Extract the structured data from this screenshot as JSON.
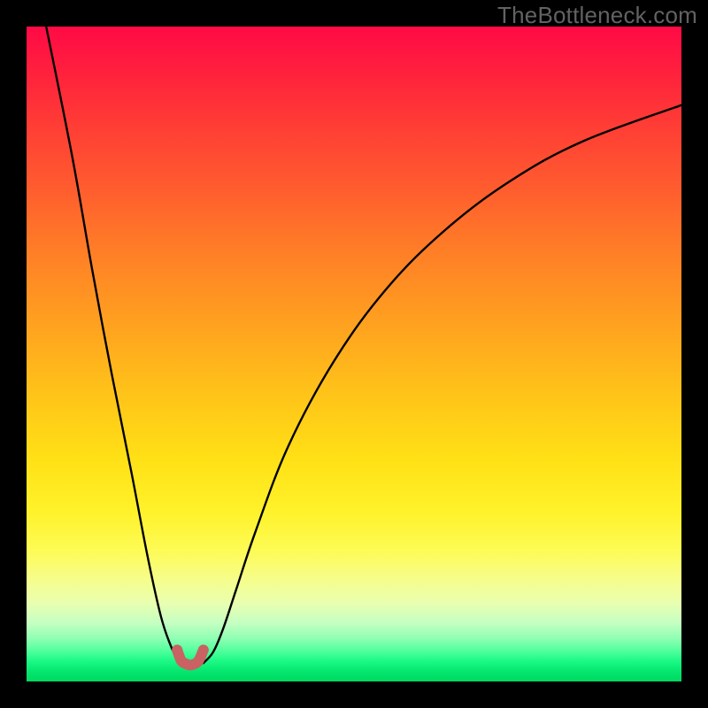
{
  "watermark": "TheBottleneck.com",
  "chart_data": {
    "type": "line",
    "title": "",
    "xlabel": "",
    "ylabel": "",
    "xlim": [
      0,
      100
    ],
    "ylim": [
      0,
      100
    ],
    "grid": false,
    "legend": false,
    "series": [
      {
        "name": "left-branch",
        "x": [
          3.0,
          7.0,
          10.0,
          13.0,
          16.0,
          18.5,
          20.5,
          22.0,
          23.0,
          24.0
        ],
        "y": [
          100.0,
          80.0,
          63.0,
          47.0,
          32.0,
          19.0,
          10.0,
          5.5,
          3.5,
          2.8
        ]
      },
      {
        "name": "right-branch",
        "x": [
          27.0,
          28.5,
          30.0,
          32.0,
          35.0,
          40.0,
          47.0,
          55.0,
          64.0,
          74.0,
          85.0,
          100.0
        ],
        "y": [
          2.8,
          4.5,
          8.0,
          14.0,
          23.0,
          36.0,
          49.0,
          60.0,
          69.0,
          76.5,
          82.5,
          88.0
        ]
      },
      {
        "name": "valley-highlight",
        "x": [
          23.0,
          23.6,
          24.3,
          25.0,
          25.7,
          26.3,
          27.0
        ],
        "y": [
          4.8,
          3.2,
          2.7,
          2.5,
          2.7,
          3.2,
          4.8
        ]
      }
    ],
    "gradient_background": {
      "direction": "vertical",
      "stops": [
        {
          "pos": 0.0,
          "color": "#ff0a46"
        },
        {
          "pos": 0.5,
          "color": "#ffb81c"
        },
        {
          "pos": 0.78,
          "color": "#fff22a"
        },
        {
          "pos": 0.92,
          "color": "#a8ffb8"
        },
        {
          "pos": 1.0,
          "color": "#00d95f"
        }
      ]
    },
    "highlight_color": "#c96262"
  }
}
